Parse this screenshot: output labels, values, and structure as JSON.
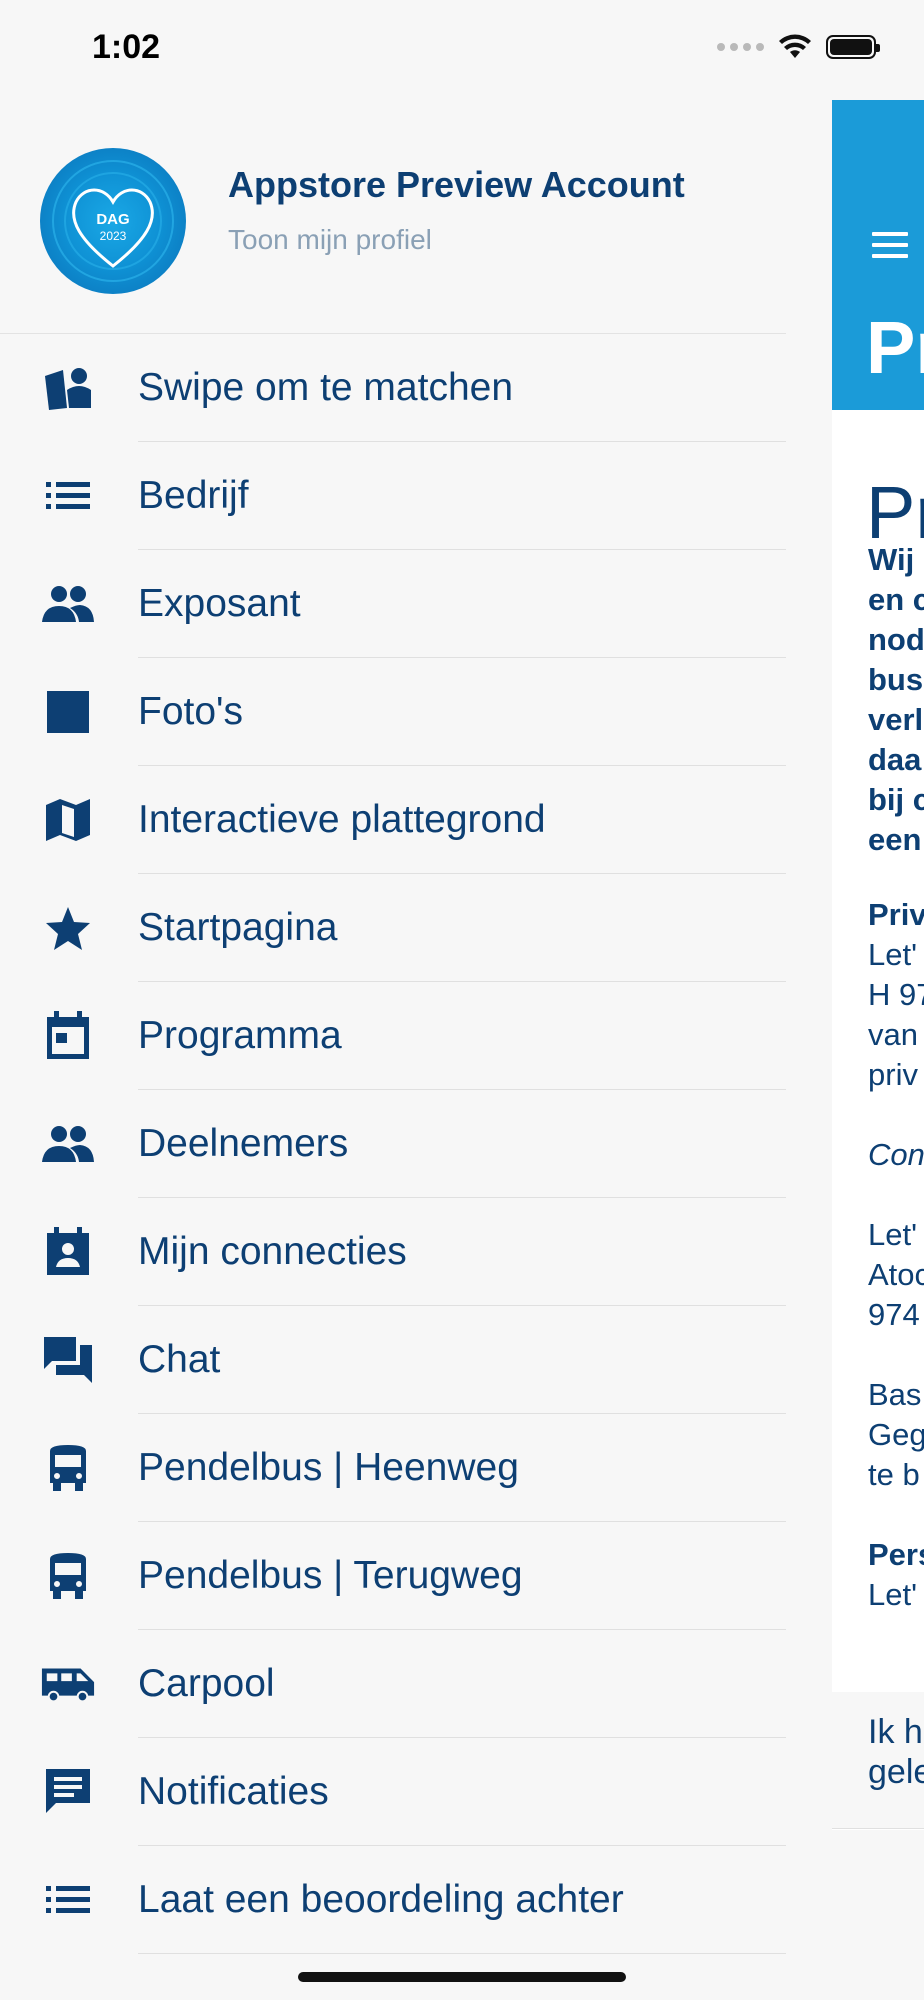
{
  "status_bar": {
    "time": "1:02"
  },
  "profile": {
    "name": "Appstore Preview Account",
    "link": "Toon mijn profiel",
    "avatar_text_top": "DAG",
    "avatar_text_year": "2023"
  },
  "menu": {
    "items": [
      {
        "label": "Swipe om te matchen",
        "icon": "swipe-match-icon"
      },
      {
        "label": "Bedrijf",
        "icon": "list-icon"
      },
      {
        "label": "Exposant",
        "icon": "people-icon"
      },
      {
        "label": "Foto's",
        "icon": "image-icon"
      },
      {
        "label": "Interactieve plattegrond",
        "icon": "map-icon"
      },
      {
        "label": "Startpagina",
        "icon": "star-icon"
      },
      {
        "label": "Programma",
        "icon": "calendar-icon"
      },
      {
        "label": "Deelnemers",
        "icon": "people-icon"
      },
      {
        "label": "Mijn connecties",
        "icon": "contact-badge-icon"
      },
      {
        "label": "Chat",
        "icon": "chat-icon"
      },
      {
        "label": "Pendelbus | Heenweg",
        "icon": "bus-icon"
      },
      {
        "label": "Pendelbus | Terugweg",
        "icon": "bus-icon"
      },
      {
        "label": "Carpool",
        "icon": "van-icon"
      },
      {
        "label": "Notificaties",
        "icon": "message-icon"
      },
      {
        "label": "Laat een beoordeling achter",
        "icon": "list-icon"
      }
    ]
  },
  "main": {
    "header_title": "Pr",
    "page_heading": "Pr",
    "lines": [
      {
        "text": "Wij",
        "style": "bold"
      },
      {
        "text": "en c",
        "style": "bold"
      },
      {
        "text": "nod",
        "style": "bold"
      },
      {
        "text": "bus",
        "style": "bold"
      },
      {
        "text": "verl",
        "style": "bold"
      },
      {
        "text": "daa",
        "style": "bold"
      },
      {
        "text": "bij c",
        "style": "bold"
      },
      {
        "text": "een",
        "style": "bold"
      },
      {
        "text": "Priv",
        "style": "bold"
      },
      {
        "text": "Let'",
        "style": "normal"
      },
      {
        "text": "H 97",
        "style": "normal"
      },
      {
        "text": "van",
        "style": "normal"
      },
      {
        "text": "priv",
        "style": "normal"
      },
      {
        "text": "Con",
        "style": "italic"
      },
      {
        "text": "Let'",
        "style": "normal"
      },
      {
        "text": "Atoc",
        "style": "normal"
      },
      {
        "text": "974",
        "style": "normal"
      },
      {
        "text": "Bas",
        "style": "normal"
      },
      {
        "text": "Geg",
        "style": "normal"
      },
      {
        "text": "te b",
        "style": "normal"
      },
      {
        "text": "Pers",
        "style": "bold"
      },
      {
        "text": "Let'",
        "style": "normal"
      }
    ],
    "consent_line1": "Ik h",
    "consent_line2": "gele"
  }
}
